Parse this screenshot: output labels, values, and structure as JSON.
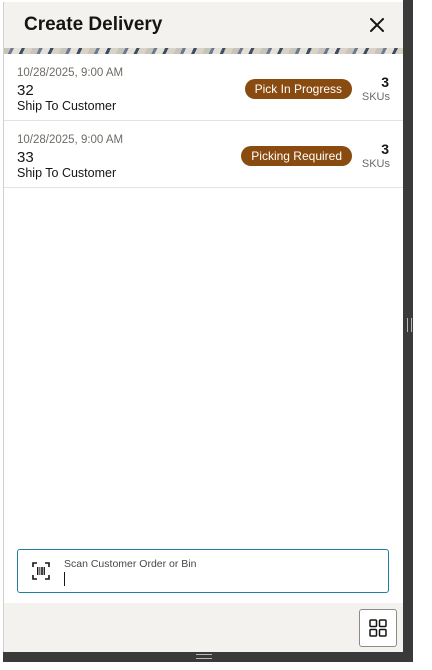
{
  "header": {
    "title": "Create Delivery"
  },
  "deliveries": [
    {
      "date": "10/28/2025, 9:00 AM",
      "id": "32",
      "type": "Ship To Customer",
      "status": "Pick In Progress",
      "sku_count": "3",
      "sku_label": "SKUs"
    },
    {
      "date": "10/28/2025, 9:00 AM",
      "id": "33",
      "type": "Ship To Customer",
      "status": "Picking Required",
      "sku_count": "3",
      "sku_label": "SKUs"
    }
  ],
  "scan": {
    "label": "Scan Customer Order or Bin",
    "value": ""
  },
  "icons": {
    "close": "close-icon",
    "barcode": "barcode-scan-icon",
    "grid": "grid-icon"
  },
  "colors": {
    "badge": "#8a4b11",
    "focus_border": "#227e9e",
    "header_bg": "#f4f2ef"
  }
}
